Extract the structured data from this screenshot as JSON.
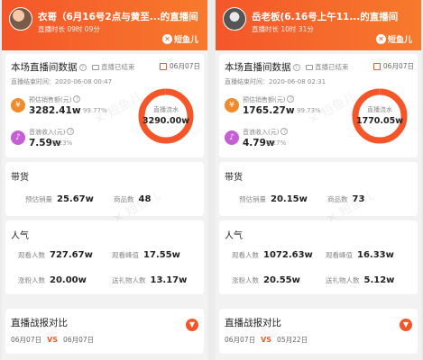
{
  "left": {
    "title": "衣哥（6月16号2点与黄至...的直播间",
    "duration": "直播时长 09时 09分",
    "brand": "短鱼儿",
    "section_title": "本场直播间数据",
    "status": "直播已结束",
    "date": "06月07日",
    "end_time": "直播结束时间：2020-06-08 00:47",
    "sales_label": "预估销售额(元)",
    "sales_value": "3282.41w",
    "sales_pct": "99.77%",
    "tip_label": "音浪收入(元)",
    "tip_value": "7.59w",
    "tip_pct": "0.23%",
    "donut_label": "直播流水",
    "donut_value": "3290.00w",
    "donut_fraction": 0.9977,
    "goods_title": "带货",
    "sold_label": "预估销量",
    "sold_value": "25.67w",
    "items_label": "商品数",
    "items_value": "48",
    "pop_title": "人气",
    "viewers_label": "观看人数",
    "viewers_value": "727.67w",
    "peak_label": "观看峰值",
    "peak_value": "17.55w",
    "fans_label": "涨粉人数",
    "fans_value": "20.00w",
    "gift_label": "送礼物人数",
    "gift_value": "13.17w",
    "compare_title": "直播战报对比",
    "cmp_date_a": "06月07日",
    "vs": "VS",
    "cmp_date_b": "06月07日"
  },
  "right": {
    "title": "岳老板(6.16号上午11...的直播间",
    "duration": "直播时长 10时 31分",
    "brand": "短鱼儿",
    "section_title": "本场直播间数据",
    "status": "直播已结束",
    "date": "06月07日",
    "end_time": "直播结束时间：2020-06-08 02:31",
    "sales_label": "预估销售额(元)",
    "sales_value": "1765.27w",
    "sales_pct": "99.73%",
    "tip_label": "音浪收入(元)",
    "tip_value": "4.79w",
    "tip_pct": "0.27%",
    "donut_label": "直播流水",
    "donut_value": "1770.05w",
    "donut_fraction": 0.9973,
    "goods_title": "带货",
    "sold_label": "预估销量",
    "sold_value": "20.15w",
    "items_label": "商品数",
    "items_value": "73",
    "pop_title": "人气",
    "viewers_label": "观看人数",
    "viewers_value": "1072.63w",
    "peak_label": "观看峰值",
    "peak_value": "16.33w",
    "fans_label": "涨粉人数",
    "fans_value": "20.55w",
    "gift_label": "送礼物人数",
    "gift_value": "5.12w",
    "compare_title": "直播战报对比",
    "cmp_date_a": "06月07日",
    "vs": "VS",
    "cmp_date_b": "05月22日"
  },
  "colors": {
    "accent": "#f4562a",
    "donut_track": "#fde3d6",
    "yen_icon": "#f08a2a",
    "note_icon": "#c65fd6"
  },
  "icons": {
    "sales": "yen-icon",
    "tips": "music-note-icon",
    "expand": "chevron-down-icon"
  }
}
